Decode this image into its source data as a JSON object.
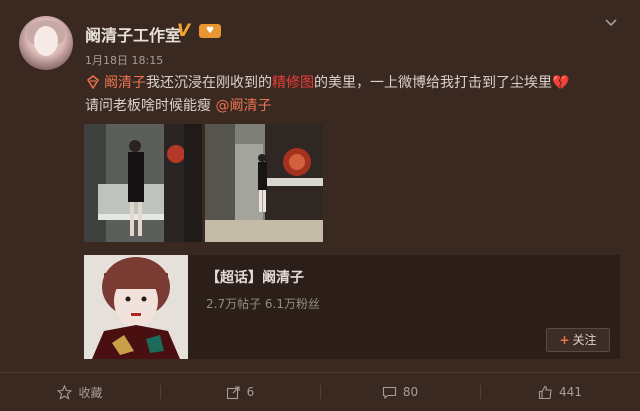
{
  "post": {
    "author": "阚清子工作室",
    "verified_mark": "V",
    "level_badge": "♥",
    "timestamp": "1月18日 18:15",
    "body": {
      "mention_link": "阚清子",
      "text1": "我还沉浸在刚收到的",
      "highlight": "精修图",
      "text2": "的美里，一上微博给我打击到了尘埃里",
      "heart": "💔",
      "text3": "请问老板啥时候能瘦 ",
      "mention2": "@阚清子"
    }
  },
  "topic": {
    "title": "【超话】阚清子",
    "posts": "2.7万帖子",
    "fans": "6.1万粉丝",
    "follow_label": "关注",
    "follow_plus": "+"
  },
  "actions": {
    "favorite_label": "收藏",
    "repost_count": "6",
    "comment_count": "80",
    "like_count": "441"
  },
  "colors": {
    "background": "#3a2921",
    "link": "#eb7350",
    "highlight": "#eb3b3b",
    "badge": "#e89532"
  }
}
